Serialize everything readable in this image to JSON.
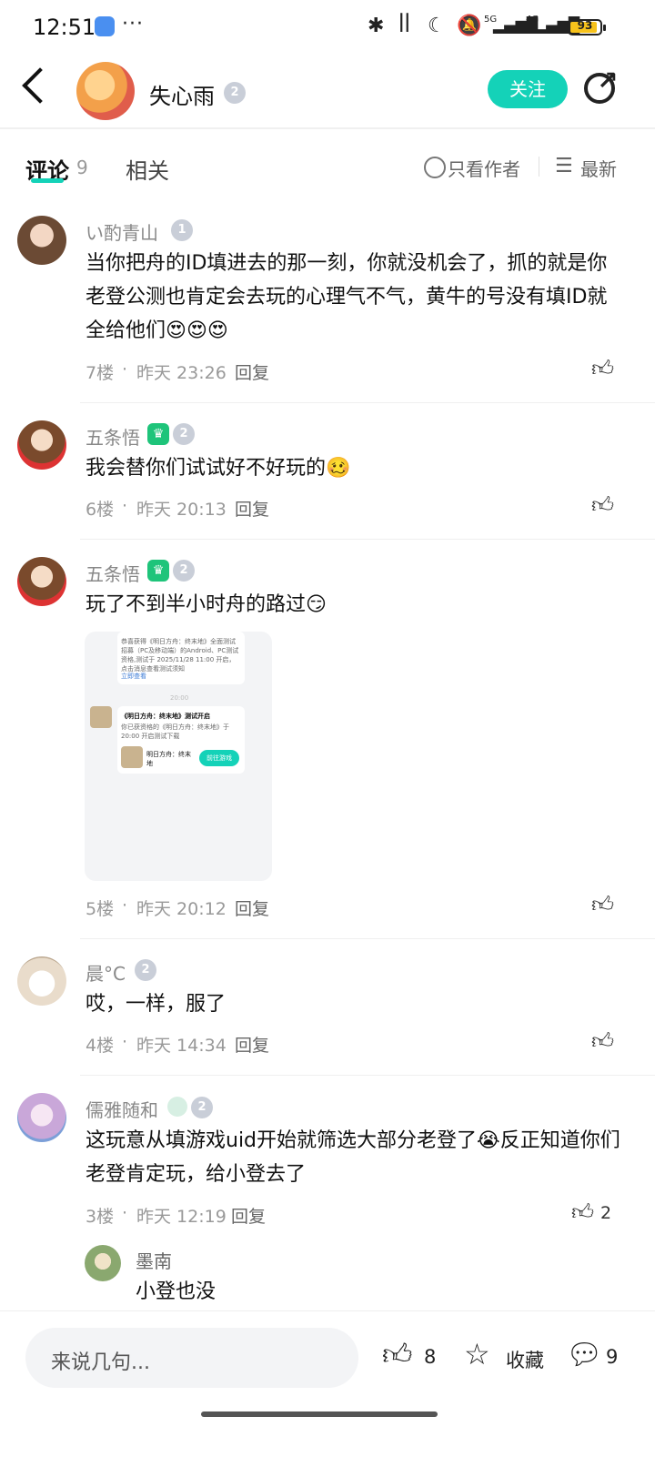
{
  "status_bar": {
    "time": "12:51",
    "more": "···",
    "network1": "5G",
    "network2": "4G",
    "battery": "93",
    "battery_level": 0.93
  },
  "header": {
    "author_name": "失心雨",
    "author_level": "2",
    "follow_label": "关注"
  },
  "tabs": {
    "comments_label": "评论",
    "comments_count": "9",
    "related_label": "相关",
    "author_only_label": "只看作者",
    "sort_label": "最新"
  },
  "comments": [
    {
      "user": "い酌青山",
      "level": "1",
      "text": "当你把舟的ID填进去的那一刻，你就没机会了，抓的就是你老登公测也肯定会去玩的心理气不气，黄牛的号没有填ID就全给他们",
      "emojis": "😍😍😍",
      "floor": "7楼",
      "time": "昨天 23:26",
      "reply": "回复"
    },
    {
      "user": "五条悟",
      "level": "2",
      "text": "我会替你们试试好不好玩的",
      "emojis": "🥴",
      "floor": "6楼",
      "time": "昨天 20:13",
      "reply": "回复"
    },
    {
      "user": "五条悟",
      "level": "2",
      "text": "玩了不到半小时舟的路过",
      "emojis": "😏",
      "floor": "5楼",
      "time": "昨天 20:12",
      "reply": "回复",
      "image": {
        "msg1": "恭喜获得《明日方舟：终末地》全面测试招募（PC及移动端）的Android、PC测试资格,测试于 2025/11/28 11:00 开启，点击消息查看测试须知",
        "msg1_link": "立即查看",
        "time": "20:00",
        "msg2_title": "《明日方舟：终末地》测试开启",
        "msg2_body": "你已获资格的《明日方舟：终末地》于20:00 开启测试下载",
        "game_name": "明日方舟：终末地",
        "game_btn": "前往游戏"
      }
    },
    {
      "user": "晨°C",
      "level": "2",
      "text": "哎，一样，服了",
      "emojis": "",
      "floor": "4楼",
      "time": "昨天 14:34",
      "reply": "回复"
    },
    {
      "user": "儒雅随和",
      "level": "2",
      "text_part1": "这玩意从填游戏uid开始就筛选大部分老登了",
      "emoji_mid": "😭",
      "text_part2": "反正知道你们老登肯定玩，给小登去了",
      "floor": "3楼",
      "time": "昨天 12:19",
      "reply": "回复",
      "likes": "2",
      "sub_reply": {
        "user": "墨南",
        "text": "小登也没"
      }
    }
  ],
  "meta_sep": "·",
  "bottom_bar": {
    "placeholder": "来说几句...",
    "like_count": "8",
    "favorite_label": "收藏",
    "comment_count": "9"
  }
}
